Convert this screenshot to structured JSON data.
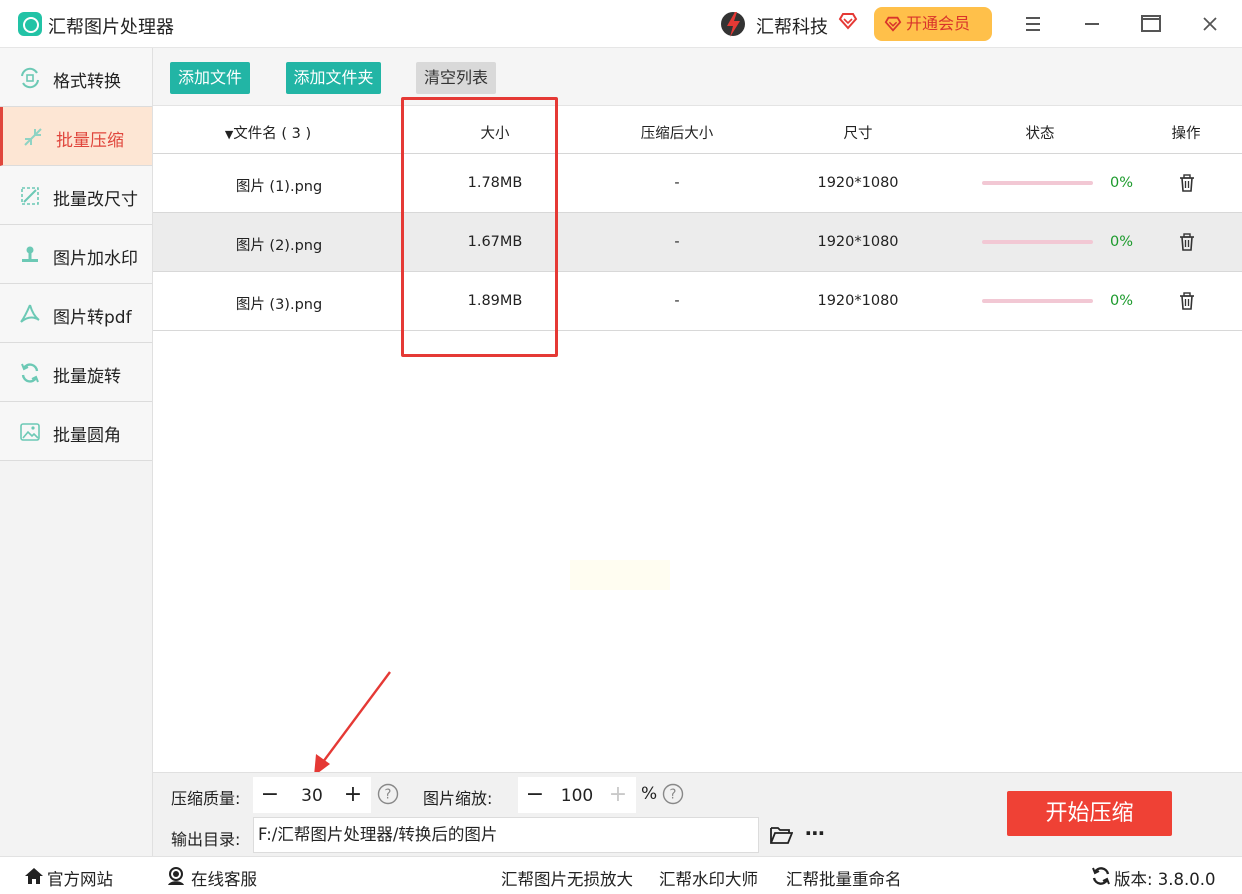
{
  "app": {
    "title": "汇帮图片处理器",
    "brand": "汇帮科技",
    "vip_label": "开通会员"
  },
  "sidebar": {
    "items": [
      {
        "label": "格式转换",
        "icon": "format-convert-icon",
        "active": false
      },
      {
        "label": "批量压缩",
        "icon": "compress-icon",
        "active": true
      },
      {
        "label": "批量改尺寸",
        "icon": "resize-icon",
        "active": false
      },
      {
        "label": "图片加水印",
        "icon": "watermark-icon",
        "active": false
      },
      {
        "label": "图片转pdf",
        "icon": "pdf-icon",
        "active": false
      },
      {
        "label": "批量旋转",
        "icon": "rotate-icon",
        "active": false
      },
      {
        "label": "批量圆角",
        "icon": "round-corner-icon",
        "active": false
      }
    ]
  },
  "toolbar": {
    "add_file": "添加文件",
    "add_folder": "添加文件夹",
    "clear_list": "清空列表"
  },
  "table": {
    "headers": {
      "name": "文件名 ( 3 )",
      "size": "大小",
      "compressed_size": "压缩后大小",
      "dimensions": "尺寸",
      "status": "状态",
      "action": "操作"
    },
    "rows": [
      {
        "name": "图片 (1).png",
        "size": "1.78MB",
        "compressed_size": "-",
        "dimensions": "1920*1080",
        "progress": 0,
        "status": "0%"
      },
      {
        "name": "图片 (2).png",
        "size": "1.67MB",
        "compressed_size": "-",
        "dimensions": "1920*1080",
        "progress": 0,
        "status": "0%"
      },
      {
        "name": "图片 (3).png",
        "size": "1.89MB",
        "compressed_size": "-",
        "dimensions": "1920*1080",
        "progress": 0,
        "status": "0%"
      }
    ]
  },
  "settings": {
    "quality_label": "压缩质量:",
    "quality_value": "30",
    "scale_label": "图片缩放:",
    "scale_value": "100",
    "scale_unit": "%",
    "output_label": "输出目录:",
    "output_path": "F:/汇帮图片处理器/转换后的图片",
    "start_button": "开始压缩"
  },
  "statusbar": {
    "website": "官方网站",
    "support": "在线客服",
    "link1": "汇帮图片无损放大",
    "link2": "汇帮水印大师",
    "link3": "汇帮批量重命名",
    "version_label": "版本: 3.8.0.0"
  },
  "colors": {
    "accent_teal": "#22b5a5",
    "accent_red": "#ef4135",
    "vip_bg": "#ffc04a",
    "progress_green": "#1c9a2c"
  }
}
